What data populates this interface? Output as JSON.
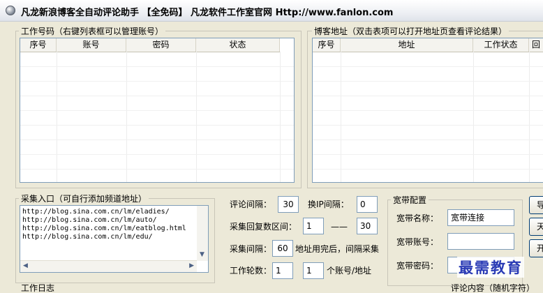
{
  "window": {
    "title": "凡龙新浪博客全自动评论助手 【全免码】 凡龙软件工作室官网 Http://www.fanlon.com"
  },
  "accounts": {
    "group_label": "工作号码（右键列表框可以管理账号）",
    "columns": [
      "序号",
      "账号",
      "密码",
      "状态"
    ]
  },
  "blogs": {
    "group_label": "博客地址（双击表项可以打开地址页查看评论结果）",
    "columns": [
      "序号",
      "地址",
      "工作状态",
      "回"
    ]
  },
  "collect": {
    "group_label": "采集入口（可自行添加频道地址）",
    "urls": [
      "http://blog.sina.com.cn/lm/eladies/",
      "http://blog.sina.com.cn/lm/auto/",
      "http://blog.sina.com.cn/lm/eatblog.html",
      "http://blog.sina.com.cn/lm/edu/"
    ]
  },
  "settings": {
    "comment_interval_label": "评论间隔：",
    "comment_interval_value": "30",
    "ip_interval_label": "换IP间隔：",
    "ip_interval_value": "0",
    "reply_range_label": "采集回复数区间：",
    "reply_min": "1",
    "range_dash": "——",
    "reply_max": "30",
    "collect_interval_label": "采集间隔：",
    "collect_interval_value": "60",
    "collect_note": "地址用完后，间隔采集",
    "rounds_label": "工作轮数：",
    "rounds_value": "1",
    "per_account_value": "1",
    "per_account_label": "个账号/地址"
  },
  "broadband": {
    "group_label": "宽带配置",
    "name_label": "宽带名称：",
    "name_value": "宽带连接",
    "account_label": "宽带账号：",
    "account_value": "",
    "password_label": "宽带密码：",
    "password_value": ""
  },
  "buttons": {
    "b1": "导",
    "b2": "天",
    "b3": "开"
  },
  "footer": {
    "log_label": "工作日志",
    "comment_label": "评论内容（随机字符）"
  },
  "watermark": "最需教育"
}
